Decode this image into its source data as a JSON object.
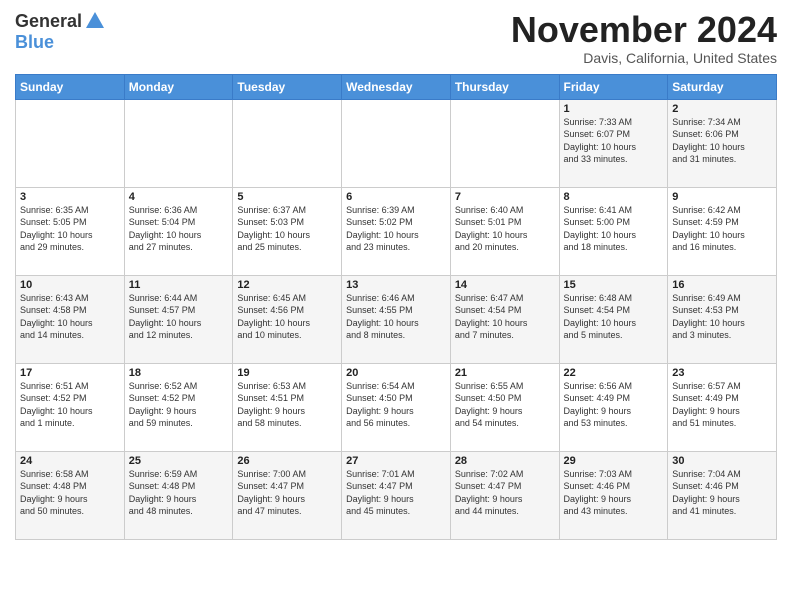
{
  "header": {
    "logo_general": "General",
    "logo_blue": "Blue",
    "month_title": "November 2024",
    "location": "Davis, California, United States"
  },
  "weekdays": [
    "Sunday",
    "Monday",
    "Tuesday",
    "Wednesday",
    "Thursday",
    "Friday",
    "Saturday"
  ],
  "weeks": [
    [
      {
        "day": "",
        "details": ""
      },
      {
        "day": "",
        "details": ""
      },
      {
        "day": "",
        "details": ""
      },
      {
        "day": "",
        "details": ""
      },
      {
        "day": "",
        "details": ""
      },
      {
        "day": "1",
        "details": "Sunrise: 7:33 AM\nSunset: 6:07 PM\nDaylight: 10 hours\nand 33 minutes."
      },
      {
        "day": "2",
        "details": "Sunrise: 7:34 AM\nSunset: 6:06 PM\nDaylight: 10 hours\nand 31 minutes."
      }
    ],
    [
      {
        "day": "3",
        "details": "Sunrise: 6:35 AM\nSunset: 5:05 PM\nDaylight: 10 hours\nand 29 minutes."
      },
      {
        "day": "4",
        "details": "Sunrise: 6:36 AM\nSunset: 5:04 PM\nDaylight: 10 hours\nand 27 minutes."
      },
      {
        "day": "5",
        "details": "Sunrise: 6:37 AM\nSunset: 5:03 PM\nDaylight: 10 hours\nand 25 minutes."
      },
      {
        "day": "6",
        "details": "Sunrise: 6:39 AM\nSunset: 5:02 PM\nDaylight: 10 hours\nand 23 minutes."
      },
      {
        "day": "7",
        "details": "Sunrise: 6:40 AM\nSunset: 5:01 PM\nDaylight: 10 hours\nand 20 minutes."
      },
      {
        "day": "8",
        "details": "Sunrise: 6:41 AM\nSunset: 5:00 PM\nDaylight: 10 hours\nand 18 minutes."
      },
      {
        "day": "9",
        "details": "Sunrise: 6:42 AM\nSunset: 4:59 PM\nDaylight: 10 hours\nand 16 minutes."
      }
    ],
    [
      {
        "day": "10",
        "details": "Sunrise: 6:43 AM\nSunset: 4:58 PM\nDaylight: 10 hours\nand 14 minutes."
      },
      {
        "day": "11",
        "details": "Sunrise: 6:44 AM\nSunset: 4:57 PM\nDaylight: 10 hours\nand 12 minutes."
      },
      {
        "day": "12",
        "details": "Sunrise: 6:45 AM\nSunset: 4:56 PM\nDaylight: 10 hours\nand 10 minutes."
      },
      {
        "day": "13",
        "details": "Sunrise: 6:46 AM\nSunset: 4:55 PM\nDaylight: 10 hours\nand 8 minutes."
      },
      {
        "day": "14",
        "details": "Sunrise: 6:47 AM\nSunset: 4:54 PM\nDaylight: 10 hours\nand 7 minutes."
      },
      {
        "day": "15",
        "details": "Sunrise: 6:48 AM\nSunset: 4:54 PM\nDaylight: 10 hours\nand 5 minutes."
      },
      {
        "day": "16",
        "details": "Sunrise: 6:49 AM\nSunset: 4:53 PM\nDaylight: 10 hours\nand 3 minutes."
      }
    ],
    [
      {
        "day": "17",
        "details": "Sunrise: 6:51 AM\nSunset: 4:52 PM\nDaylight: 10 hours\nand 1 minute."
      },
      {
        "day": "18",
        "details": "Sunrise: 6:52 AM\nSunset: 4:52 PM\nDaylight: 9 hours\nand 59 minutes."
      },
      {
        "day": "19",
        "details": "Sunrise: 6:53 AM\nSunset: 4:51 PM\nDaylight: 9 hours\nand 58 minutes."
      },
      {
        "day": "20",
        "details": "Sunrise: 6:54 AM\nSunset: 4:50 PM\nDaylight: 9 hours\nand 56 minutes."
      },
      {
        "day": "21",
        "details": "Sunrise: 6:55 AM\nSunset: 4:50 PM\nDaylight: 9 hours\nand 54 minutes."
      },
      {
        "day": "22",
        "details": "Sunrise: 6:56 AM\nSunset: 4:49 PM\nDaylight: 9 hours\nand 53 minutes."
      },
      {
        "day": "23",
        "details": "Sunrise: 6:57 AM\nSunset: 4:49 PM\nDaylight: 9 hours\nand 51 minutes."
      }
    ],
    [
      {
        "day": "24",
        "details": "Sunrise: 6:58 AM\nSunset: 4:48 PM\nDaylight: 9 hours\nand 50 minutes."
      },
      {
        "day": "25",
        "details": "Sunrise: 6:59 AM\nSunset: 4:48 PM\nDaylight: 9 hours\nand 48 minutes."
      },
      {
        "day": "26",
        "details": "Sunrise: 7:00 AM\nSunset: 4:47 PM\nDaylight: 9 hours\nand 47 minutes."
      },
      {
        "day": "27",
        "details": "Sunrise: 7:01 AM\nSunset: 4:47 PM\nDaylight: 9 hours\nand 45 minutes."
      },
      {
        "day": "28",
        "details": "Sunrise: 7:02 AM\nSunset: 4:47 PM\nDaylight: 9 hours\nand 44 minutes."
      },
      {
        "day": "29",
        "details": "Sunrise: 7:03 AM\nSunset: 4:46 PM\nDaylight: 9 hours\nand 43 minutes."
      },
      {
        "day": "30",
        "details": "Sunrise: 7:04 AM\nSunset: 4:46 PM\nDaylight: 9 hours\nand 41 minutes."
      }
    ]
  ]
}
